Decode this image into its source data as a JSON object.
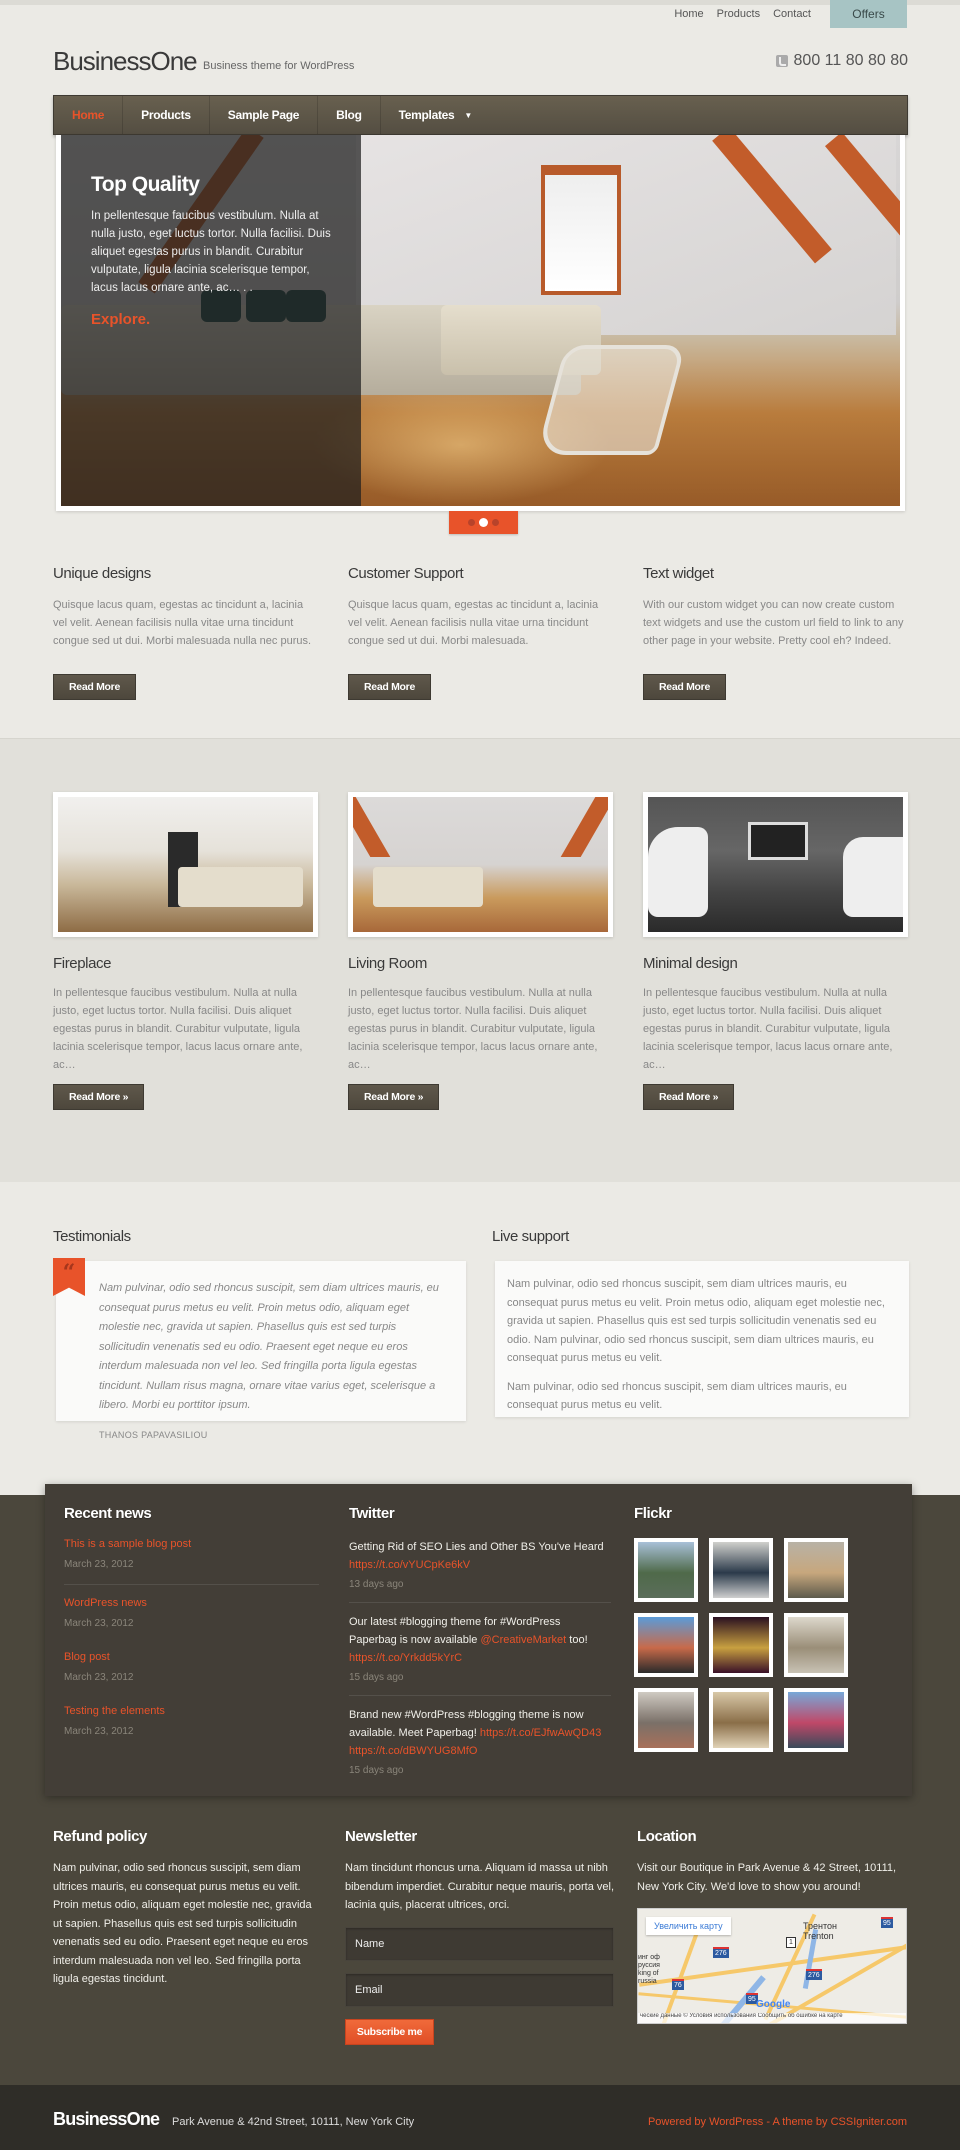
{
  "top_nav": {
    "items": [
      "Home",
      "Products",
      "Contact"
    ],
    "offers_label": "Offers"
  },
  "header": {
    "logo": "BusinessOne",
    "tagline": "Business theme for WordPress",
    "phone": "800 11 80 80 80",
    "phone_icon": "phone-icon"
  },
  "main_nav": {
    "items": [
      {
        "label": "Home",
        "active": true
      },
      {
        "label": "Products"
      },
      {
        "label": "Sample Page"
      },
      {
        "label": "Blog"
      },
      {
        "label": "Templates",
        "has_dropdown": true
      }
    ]
  },
  "slider": {
    "title": "Top Quality",
    "text": "In pellentesque faucibus vestibulum. Nulla at nulla justo, eget luctus tortor. Nulla facilisi. Duis aliquet egestas purus in blandit. Curabitur vulputate, ligula lacinia scelerisque tempor, lacus lacus ornare ante, ac… . .",
    "link": "Explore.",
    "slide_count": 3,
    "active_slide": 2
  },
  "features": [
    {
      "title": "Unique designs",
      "text": "Quisque lacus quam, egestas ac tincidunt a, lacinia vel velit. Aenean facilisis nulla vitae urna tincidunt congue sed ut dui. Morbi malesuada nulla nec purus.",
      "button": "Read More"
    },
    {
      "title": "Customer Support",
      "text": "Quisque lacus quam, egestas ac tincidunt a, lacinia vel velit. Aenean facilisis nulla vitae urna tincidunt congue sed ut dui. Morbi malesuada.",
      "button": "Read More"
    },
    {
      "title": "Text widget",
      "text": "With our custom widget you can now create custom text widgets and use the custom url field to link to any other page in your website. Pretty cool eh? Indeed.",
      "button": "Read More"
    }
  ],
  "gallery": [
    {
      "title": "Fireplace",
      "text": "In pellentesque faucibus vestibulum. Nulla at nulla justo, eget luctus tortor. Nulla facilisi. Duis aliquet egestas purus in blandit. Curabitur vulputate, ligula lacinia scelerisque tempor, lacus lacus ornare ante, ac…",
      "button": "Read More »"
    },
    {
      "title": "Living Room",
      "text": "In pellentesque faucibus vestibulum. Nulla at nulla justo, eget luctus tortor. Nulla facilisi. Duis aliquet egestas purus in blandit. Curabitur vulputate, ligula lacinia scelerisque tempor, lacus lacus ornare ante, ac…",
      "button": "Read More »"
    },
    {
      "title": "Minimal design",
      "text": "In pellentesque faucibus vestibulum. Nulla at nulla justo, eget luctus tortor. Nulla facilisi. Duis aliquet egestas purus in blandit. Curabitur vulputate, ligula lacinia scelerisque tempor, lacus lacus ornare ante, ac…",
      "button": "Read More »"
    }
  ],
  "testimonials": {
    "title": "Testimonials",
    "quote_icon": "quote-icon",
    "quote": "Nam pulvinar, odio sed rhoncus suscipit, sem diam ultrices mauris, eu consequat purus metus eu velit. Proin metus odio, aliquam eget molestie nec, gravida ut sapien. Phasellus quis est sed turpis sollicitudin venenatis sed eu odio. Praesent eget neque eu eros interdum malesuada non vel leo. Sed fringilla porta ligula egestas tincidunt. Nullam risus magna, ornare vitae varius eget, scelerisque a libero. Morbi eu porttitor ipsum.",
    "author": "THANOS PAPAVASILIOU"
  },
  "live_support": {
    "title": "Live support",
    "paragraphs": [
      "Nam pulvinar, odio sed rhoncus suscipit, sem diam ultrices mauris, eu consequat purus metus eu velit. Proin metus odio, aliquam eget molestie nec, gravida ut sapien. Phasellus quis est sed turpis sollicitudin venenatis sed eu odio. Nam pulvinar, odio sed rhoncus suscipit, sem diam ultrices mauris, eu consequat purus metus eu velit.",
      "Nam pulvinar, odio sed rhoncus suscipit, sem diam ultrices mauris, eu consequat purus metus eu velit."
    ]
  },
  "recent_news": {
    "title": "Recent news",
    "items": [
      {
        "title": "This is a sample blog post",
        "date": "March 23, 2012"
      },
      {
        "title": "WordPress news",
        "date": "March 23, 2012"
      },
      {
        "title": "Blog post",
        "date": "March 23, 2012"
      },
      {
        "title": "Testing the elements",
        "date": "March 23, 2012"
      }
    ]
  },
  "twitter": {
    "title": "Twitter",
    "tweets": [
      {
        "text": "Getting Rid of SEO Lies and Other BS You've Heard",
        "links": [
          "https://t.co/vYUCpKe6kV"
        ],
        "ago": "13 days ago"
      },
      {
        "text": "Our latest #blogging theme for #WordPress Paperbag is now available",
        "mention": "@CreativeMarket",
        "after": "too!",
        "links": [
          "https://t.co/Yrkdd5kYrC"
        ],
        "ago": "15 days ago"
      },
      {
        "text": "Brand new #WordPress #blogging theme is now available. Meet Paperbag!",
        "links": [
          "https://t.co/EJfwAwQD43",
          "https://t.co/dBWYUG8MfO"
        ],
        "ago": "15 days ago"
      }
    ]
  },
  "flickr": {
    "title": "Flickr",
    "thumbs": [
      {
        "name": "river",
        "colors": [
          "#a8c0d8",
          "#4f6a4a",
          "#5b6d5a"
        ]
      },
      {
        "name": "speedometer",
        "colors": [
          "#d0d0cc",
          "#2b3a4a",
          "#cfcfcf"
        ]
      },
      {
        "name": "lighthouse",
        "colors": [
          "#b8b2a6",
          "#c7a77d",
          "#5d5a4c"
        ]
      },
      {
        "name": "canal-houses",
        "colors": [
          "#5b9bd8",
          "#c86a4a",
          "#2a2a2a"
        ]
      },
      {
        "name": "bar",
        "colors": [
          "#2a1020",
          "#c8a040",
          "#3a1028"
        ]
      },
      {
        "name": "casa-batllo",
        "colors": [
          "#ddd8cc",
          "#9a8e78",
          "#c8c2b4"
        ]
      },
      {
        "name": "building",
        "colors": [
          "#cfcac2",
          "#7a7068",
          "#a8705a"
        ]
      },
      {
        "name": "statue",
        "colors": [
          "#d8c8a8",
          "#8a6e48",
          "#e0d2b6"
        ]
      },
      {
        "name": "graffiti",
        "colors": [
          "#78a8d8",
          "#c04868",
          "#3a4a5a"
        ]
      }
    ]
  },
  "refund": {
    "title": "Refund policy",
    "text": "Nam pulvinar, odio sed rhoncus suscipit, sem diam ultrices mauris, eu consequat purus metus eu velit. Proin metus odio, aliquam eget molestie nec, gravida ut sapien. Phasellus quis est sed turpis sollicitudin venenatis sed eu odio. Praesent eget neque eu eros interdum malesuada non vel leo. Sed fringilla porta ligula egestas tincidunt."
  },
  "newsletter": {
    "title": "Newsletter",
    "text": "Nam tincidunt rhoncus urna. Aliquam id massa ut nibh bibendum imperdiet. Curabitur neque mauris, porta vel, lacinia quis, placerat ultrices, orci.",
    "name_placeholder": "Name",
    "email_placeholder": "Email",
    "button": "Subscribe me"
  },
  "location": {
    "title": "Location",
    "text": "Visit our Boutique in Park Avenue & 42 Street, 10111, New York City. We'd love to show you around!",
    "map": {
      "enlarge_label": "Увеличить карту",
      "city_ru": "Трентон",
      "city_en": "Trenton",
      "left_label": "инг оф\nруссия\nking of\nrussia",
      "shields": [
        "276",
        "1",
        "276",
        "76",
        "95",
        "95"
      ],
      "google": "Google",
      "attribution": "ческие данные © Условия использования    Сообщить об ошибке на карте"
    }
  },
  "footer": {
    "logo": "BusinessOne",
    "address": "Park Avenue & 42nd Street, 10111, New York City",
    "powered": "Powered by WordPress",
    "separator": " - ",
    "theme_by": "A theme by CSSIgniter.com"
  },
  "colors": {
    "accent": "#e8532a",
    "nav_bg": "#5e5748",
    "footer_bg": "#4b473c",
    "widget_bg": "#433e37",
    "bottom_bar": "#2f2d28",
    "page_bg": "#ebeae5",
    "offers_bg": "#a7c4c4"
  }
}
